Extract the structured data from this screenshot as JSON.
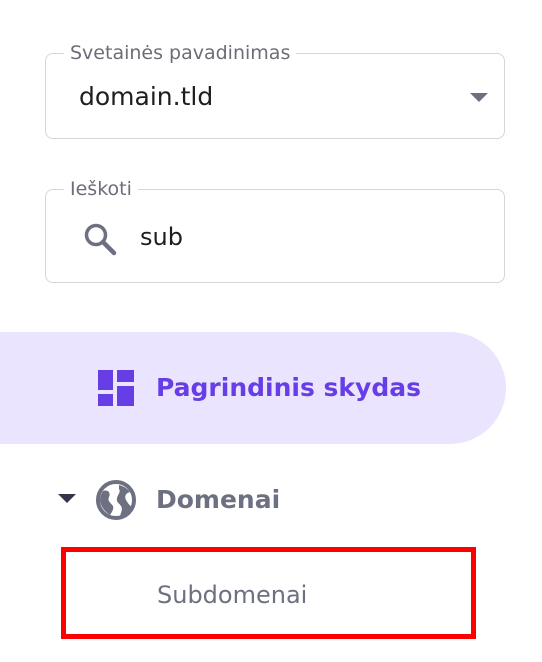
{
  "site_select": {
    "legend": "Svetainės pavadinimas",
    "value": "domain.tld"
  },
  "search": {
    "legend": "Ieškoti",
    "value": "sub"
  },
  "nav": {
    "dashboard_label": "Pagrindinis skydas",
    "domains_label": "Domenai",
    "subdomains_label": "Subdomenai"
  },
  "icons": {
    "dropdown": "chevron-down-icon",
    "search": "search-icon",
    "dashboard": "dashboard-icon",
    "expand": "caret-down-icon",
    "domains": "globe-icon"
  },
  "colors": {
    "accent": "#673de6",
    "active_bg": "#ebe4ff",
    "muted_text": "#6d7081",
    "highlight_border": "#ff0000"
  }
}
